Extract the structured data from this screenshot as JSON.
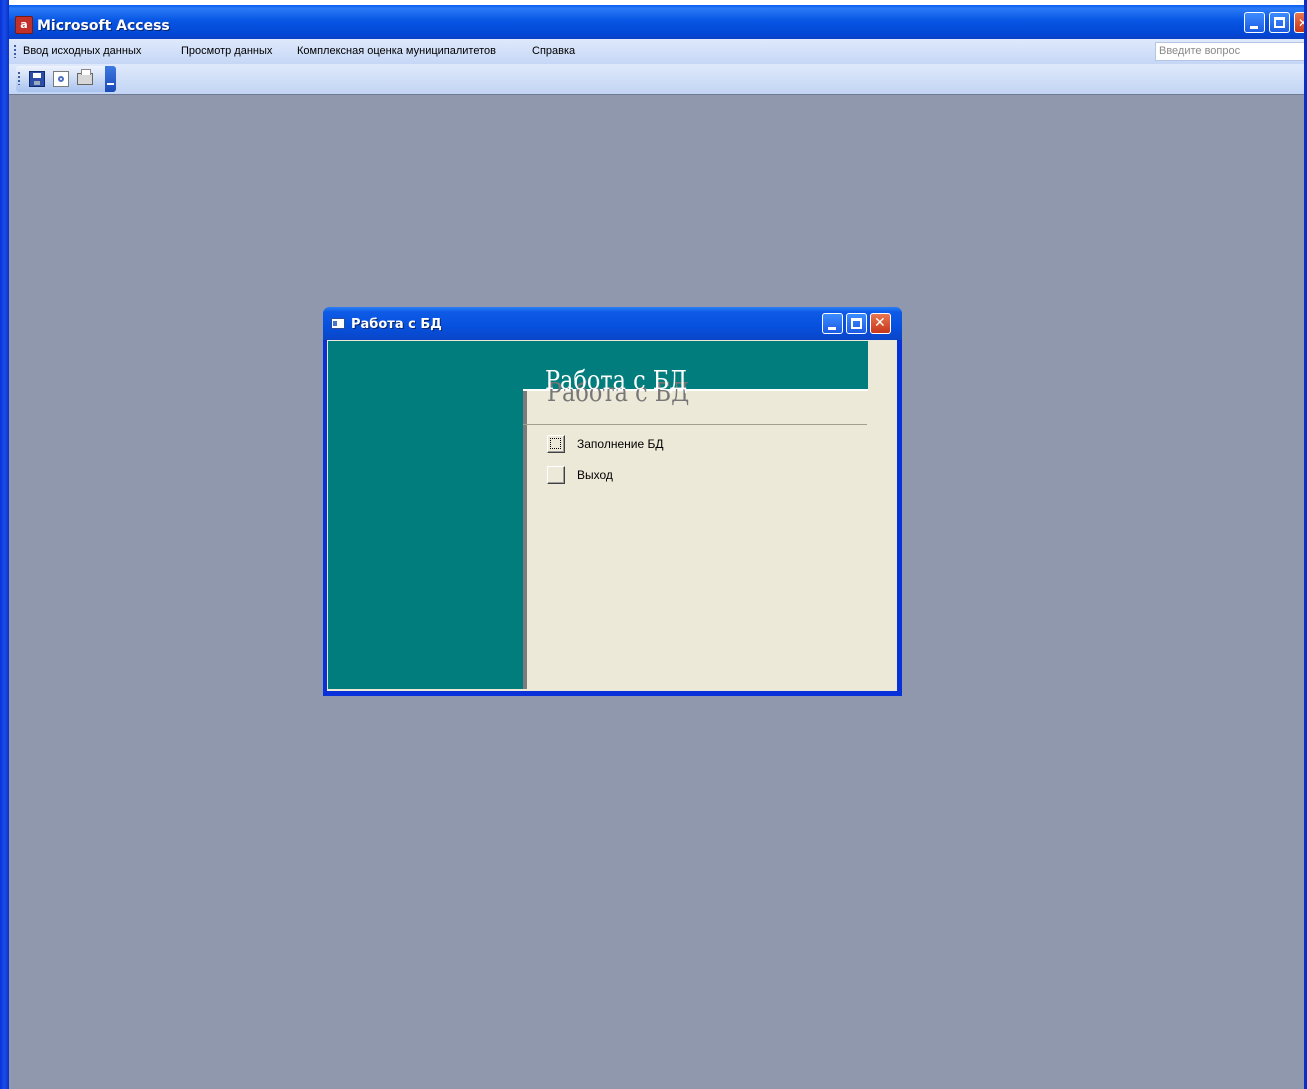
{
  "app": {
    "title": "Microsoft Access"
  },
  "menu": {
    "items": [
      "Ввод исходных данных",
      "Просмотр данных",
      "Комплексная оценка муниципалитетов",
      "Справка"
    ],
    "ask_placeholder": "Введите вопрос"
  },
  "toolbar": {
    "icons": [
      "save-icon",
      "print-preview-icon",
      "print-icon",
      "toolbar-options-icon"
    ]
  },
  "form": {
    "window_title": "Работа с БД",
    "heading": "Работа с БД",
    "buttons": [
      {
        "label": "Заполнение БД",
        "focused": true
      },
      {
        "label": "Выход",
        "focused": false
      }
    ]
  },
  "colors": {
    "workspace": "#8f98ad",
    "titlebar": "#0856e4",
    "teal": "#017d7d",
    "form_background": "#ece9d8"
  }
}
